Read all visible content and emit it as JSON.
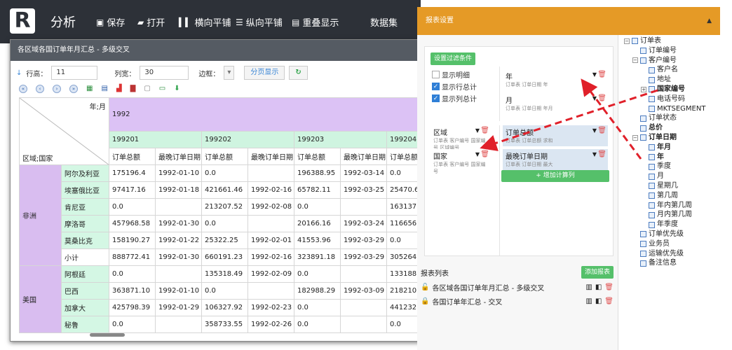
{
  "app": {
    "logo": "R",
    "title": "分析"
  },
  "toolbar": [
    {
      "icon": "save-icon",
      "glyph": "▣",
      "label": "保存"
    },
    {
      "icon": "folder-icon",
      "glyph": "▰",
      "label": "打开"
    },
    {
      "icon": "columns-icon",
      "glyph": "▍▍",
      "label": "横向平铺"
    },
    {
      "icon": "rows-icon",
      "glyph": "☰",
      "label": "纵向平铺"
    },
    {
      "icon": "overlap-icon",
      "glyph": "▤",
      "label": "重叠显示"
    },
    {
      "icon": "",
      "glyph": "",
      "label": "数据集"
    }
  ],
  "report": {
    "title": "各区域各国订单年月汇总 - 多级交叉",
    "controls": {
      "row_height_label": "行高：",
      "row_height": "11",
      "col_width_label": "列宽：",
      "col_width": "30",
      "border_label": "边框：",
      "paging_button": "分页显示"
    },
    "corner_top": "年;月",
    "corner_bottom": "区域;国家",
    "year": "1992",
    "months": [
      "199201",
      "199202",
      "199203",
      "199204"
    ],
    "measures": [
      "订单总额",
      "最晚订单日期",
      "订单总额",
      "最晚订单日期",
      "订单总额",
      "最晚订单日期",
      "订单总额"
    ],
    "groups": [
      {
        "region": "非洲",
        "rows": [
          {
            "country": "阿尔及利亚",
            "v": [
              "175196.4",
              "1992-01-10",
              "0.0",
              "",
              "196388.95",
              "1992-03-14",
              "0.0"
            ]
          },
          {
            "country": "埃塞俄比亚",
            "v": [
              "97417.16",
              "1992-01-18",
              "421661.46",
              "1992-02-16",
              "65782.11",
              "1992-03-25",
              "25470.6"
            ]
          },
          {
            "country": "肯尼亚",
            "v": [
              "0.0",
              "",
              "213207.52",
              "1992-02-08",
              "0.0",
              "",
              "163137."
            ]
          },
          {
            "country": "摩洛哥",
            "v": [
              "457968.58",
              "1992-01-30",
              "0.0",
              "",
              "20166.16",
              "1992-03-24",
              "116656."
            ]
          },
          {
            "country": "莫桑比克",
            "v": [
              "158190.27",
              "1992-01-22",
              "25322.25",
              "1992-02-01",
              "41553.96",
              "1992-03-29",
              "0.0"
            ]
          },
          {
            "country": "小计",
            "v": [
              "888772.41",
              "1992-01-30",
              "660191.23",
              "1992-02-16",
              "323891.18",
              "1992-03-29",
              "305264."
            ],
            "subtotal": true
          }
        ]
      },
      {
        "region": "美国",
        "rows": [
          {
            "country": "阿根廷",
            "v": [
              "0.0",
              "",
              "135318.49",
              "1992-02-09",
              "0.0",
              "",
              "133188."
            ]
          },
          {
            "country": "巴西",
            "v": [
              "363871.10",
              "1992-01-10",
              "0.0",
              "",
              "182988.29",
              "1992-03-09",
              "218210."
            ]
          },
          {
            "country": "加拿大",
            "v": [
              "425798.39",
              "1992-01-29",
              "106327.92",
              "1992-02-23",
              "0.0",
              "",
              "441232."
            ]
          },
          {
            "country": "秘鲁",
            "v": [
              "0.0",
              "",
              "358733.55",
              "1992-02-26",
              "0.0",
              "",
              "0.0"
            ]
          }
        ]
      }
    ]
  },
  "settings": {
    "header": "报表设置",
    "filter_button": "设置过滤条件",
    "checks": [
      {
        "label": "显示明细",
        "on": false
      },
      {
        "label": "显示行总计",
        "on": true
      },
      {
        "label": "显示列总计",
        "on": true
      }
    ],
    "col_fields": [
      {
        "name": "年",
        "sub": "订单表 订单日期 年"
      },
      {
        "name": "月",
        "sub": "订单表 订单日期 年月"
      }
    ],
    "row_fields": [
      {
        "name": "区域",
        "sub": "订单表 客户编号 国家编号 区域编号"
      },
      {
        "name": "国家",
        "sub": "订单表 客户编号 国家编号"
      }
    ],
    "measures": [
      {
        "name": "订单总额",
        "sub": "订单表 订单总额 求和"
      },
      {
        "name": "最晚订单日期",
        "sub": "订单表 订单日期 最大"
      }
    ],
    "add_measure": "+ 增加计算列",
    "report_list_label": "报表列表",
    "add_report": "添加报表",
    "reports": [
      {
        "name": "各区域各国订单年月汇总 - 多级交叉",
        "locked": false
      },
      {
        "name": "各国订单年汇总 - 交叉",
        "locked": true
      }
    ]
  },
  "tree": [
    {
      "label": "订单表",
      "level": 0,
      "exp": "−"
    },
    {
      "label": "订单编号",
      "level": 1
    },
    {
      "label": "客户编号",
      "level": 1,
      "exp": "−"
    },
    {
      "label": "客户名",
      "level": 2
    },
    {
      "label": "地址",
      "level": 2
    },
    {
      "label": "国家编号",
      "level": 2,
      "exp": "+",
      "bold": true
    },
    {
      "label": "电话号码",
      "level": 2
    },
    {
      "label": "MKTSEGMENT",
      "level": 2
    },
    {
      "label": "订单状态",
      "level": 1
    },
    {
      "label": "总价",
      "level": 1,
      "bold": true
    },
    {
      "label": "订单日期",
      "level": 1,
      "exp": "−",
      "bold": true
    },
    {
      "label": "年月",
      "level": 2,
      "bold": true
    },
    {
      "label": "年",
      "level": 2,
      "bold": true
    },
    {
      "label": "季度",
      "level": 2
    },
    {
      "label": "月",
      "level": 2
    },
    {
      "label": "星期几",
      "level": 2
    },
    {
      "label": "第几周",
      "level": 2
    },
    {
      "label": "年内第几周",
      "level": 2
    },
    {
      "label": "月内第几周",
      "level": 2
    },
    {
      "label": "年季度",
      "level": 2
    },
    {
      "label": "订单优先级",
      "level": 1
    },
    {
      "label": "业务员",
      "level": 1
    },
    {
      "label": "运输优先级",
      "level": 1
    },
    {
      "label": "备注信息",
      "level": 1
    }
  ]
}
